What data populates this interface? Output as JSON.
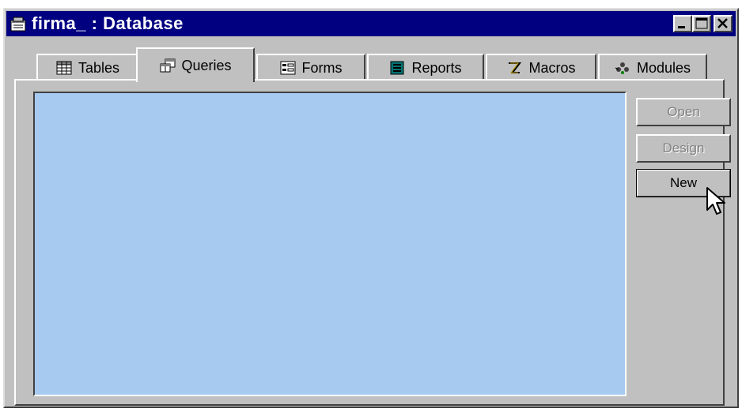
{
  "window": {
    "title": "firma_ : Database",
    "icon": "database-window-icon",
    "title_bar_color": "#000080",
    "controls": [
      "minimize-icon",
      "maximize-icon",
      "close-icon"
    ]
  },
  "tabs": [
    {
      "label": "Tables",
      "icon": "table-icon",
      "active": false
    },
    {
      "label": "Queries",
      "icon": "query-icon",
      "active": true
    },
    {
      "label": "Forms",
      "icon": "form-icon",
      "active": false
    },
    {
      "label": "Reports",
      "icon": "report-icon",
      "active": false
    },
    {
      "label": "Macros",
      "icon": "macro-icon",
      "active": false
    },
    {
      "label": "Modules",
      "icon": "module-icon",
      "active": false
    }
  ],
  "list": {
    "items": [],
    "background": "#a6caf0"
  },
  "buttons": {
    "open": {
      "label": "Open",
      "enabled": false
    },
    "design": {
      "label": "Design",
      "enabled": false
    },
    "new": {
      "label": "New",
      "enabled": true
    }
  }
}
